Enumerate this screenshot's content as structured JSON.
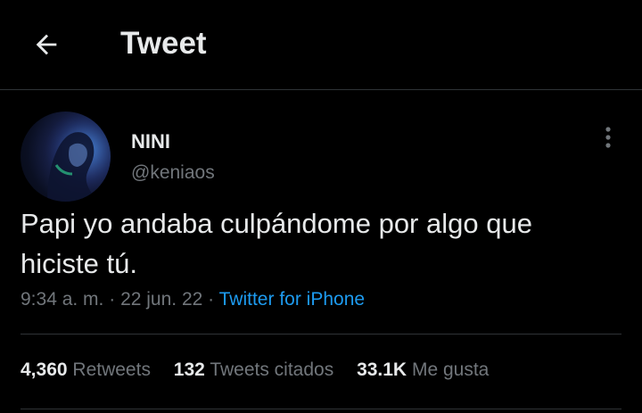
{
  "header": {
    "title": "Tweet",
    "back_icon": "arrow-left-icon"
  },
  "author": {
    "display_name": "NINI",
    "handle": "@keniaos",
    "avatar_icon": "avatar-photo"
  },
  "tweet": {
    "text": "Papi yo andaba culpándome por algo que hiciste tú.",
    "time": "9:34 a. m.",
    "separator": "·",
    "date": "22 jun. 22",
    "source": "Twitter for iPhone"
  },
  "stats": {
    "retweets_count": "4,360",
    "retweets_label": "Retweets",
    "quotes_count": "132",
    "quotes_label": "Tweets citados",
    "likes_count": "33.1K",
    "likes_label": "Me gusta"
  },
  "colors": {
    "background": "#000000",
    "text_primary": "#e7e9ea",
    "text_secondary": "#71767b",
    "accent": "#1d9bf0",
    "divider": "#2f3336"
  }
}
